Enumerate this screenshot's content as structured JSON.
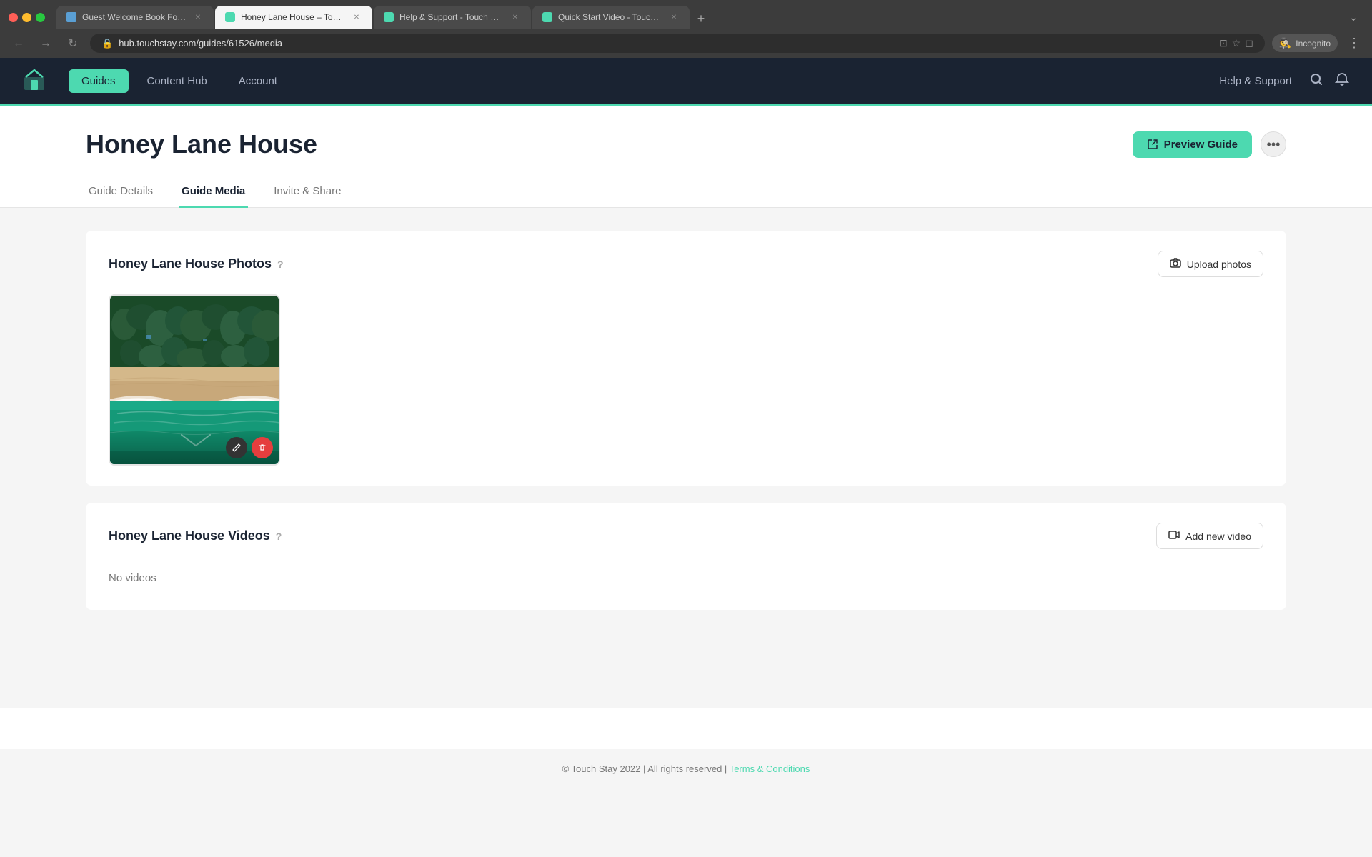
{
  "browser": {
    "tabs": [
      {
        "id": "tab1",
        "label": "Guest Welcome Book For Vaca...",
        "active": false,
        "favicon": "book"
      },
      {
        "id": "tab2",
        "label": "Honey Lane House – Touch St...",
        "active": true,
        "favicon": "house"
      },
      {
        "id": "tab3",
        "label": "Help & Support - Touch Stay",
        "active": false,
        "favicon": "help"
      },
      {
        "id": "tab4",
        "label": "Quick Start Video - Touch Stay",
        "active": false,
        "favicon": "video"
      }
    ],
    "address": "hub.touchstay.com/guides/61526/media",
    "incognito_label": "Incognito"
  },
  "header": {
    "logo_icon": "🏠",
    "nav_items": [
      {
        "id": "guides",
        "label": "Guides",
        "active": true
      },
      {
        "id": "content-hub",
        "label": "Content Hub",
        "active": false
      },
      {
        "id": "account",
        "label": "Account",
        "active": false
      }
    ],
    "help_label": "Help & Support",
    "search_icon": "search",
    "bell_icon": "bell"
  },
  "page": {
    "title": "Honey Lane House",
    "preview_btn_label": "Preview Guide",
    "more_icon": "⋯",
    "tabs": [
      {
        "id": "guide-details",
        "label": "Guide Details",
        "active": false
      },
      {
        "id": "guide-media",
        "label": "Guide Media",
        "active": true
      },
      {
        "id": "invite-share",
        "label": "Invite & Share",
        "active": false
      }
    ]
  },
  "photos_section": {
    "title": "Honey Lane House Photos",
    "upload_btn_label": "Upload photos",
    "upload_icon": "📷",
    "photos": [
      {
        "id": "photo1",
        "alt": "Aerial beach photo"
      }
    ]
  },
  "videos_section": {
    "title": "Honey Lane House Videos",
    "add_video_btn_label": "Add new video",
    "add_video_icon": "🎬",
    "no_videos_text": "No videos"
  },
  "footer": {
    "copyright": "© Touch Stay 2022 | All rights reserved |",
    "terms_label": "Terms & Conditions",
    "terms_url": "#"
  }
}
